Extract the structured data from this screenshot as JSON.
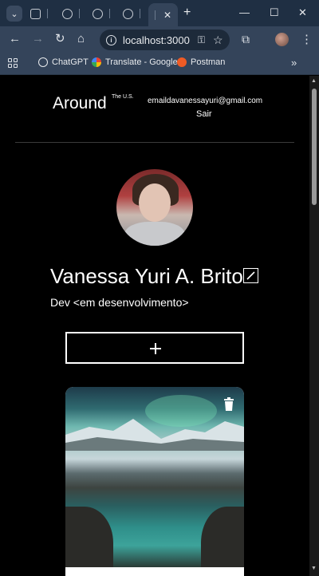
{
  "browser": {
    "active_tab_close": "✕",
    "new_tab": "+",
    "url": "localhost:3000",
    "bookmarks": [
      {
        "label": "ChatGPT",
        "icon": "chatgpt-icon",
        "color": "#e8eaed"
      },
      {
        "label": "Translate - Google",
        "icon": "google-icon",
        "color": "#4285f4"
      },
      {
        "label": "Postman",
        "icon": "postman-icon",
        "color": "#ef5b25"
      }
    ],
    "more": "»",
    "window_controls": {
      "minimize": "—",
      "maximize": "☐",
      "close": "✕"
    }
  },
  "header": {
    "logo": "Around",
    "logo_sup": "The U.S.",
    "email": "emaildavanessayuri@gmail.com",
    "logout": "Sair"
  },
  "profile": {
    "name": "Vanessa Yuri A. Brito",
    "about": "Dev <em desenvolvimento>"
  },
  "colors": {
    "background": "#000000",
    "text": "#ffffff",
    "chrome": "#34445a",
    "tabbar": "#1f2f43"
  }
}
